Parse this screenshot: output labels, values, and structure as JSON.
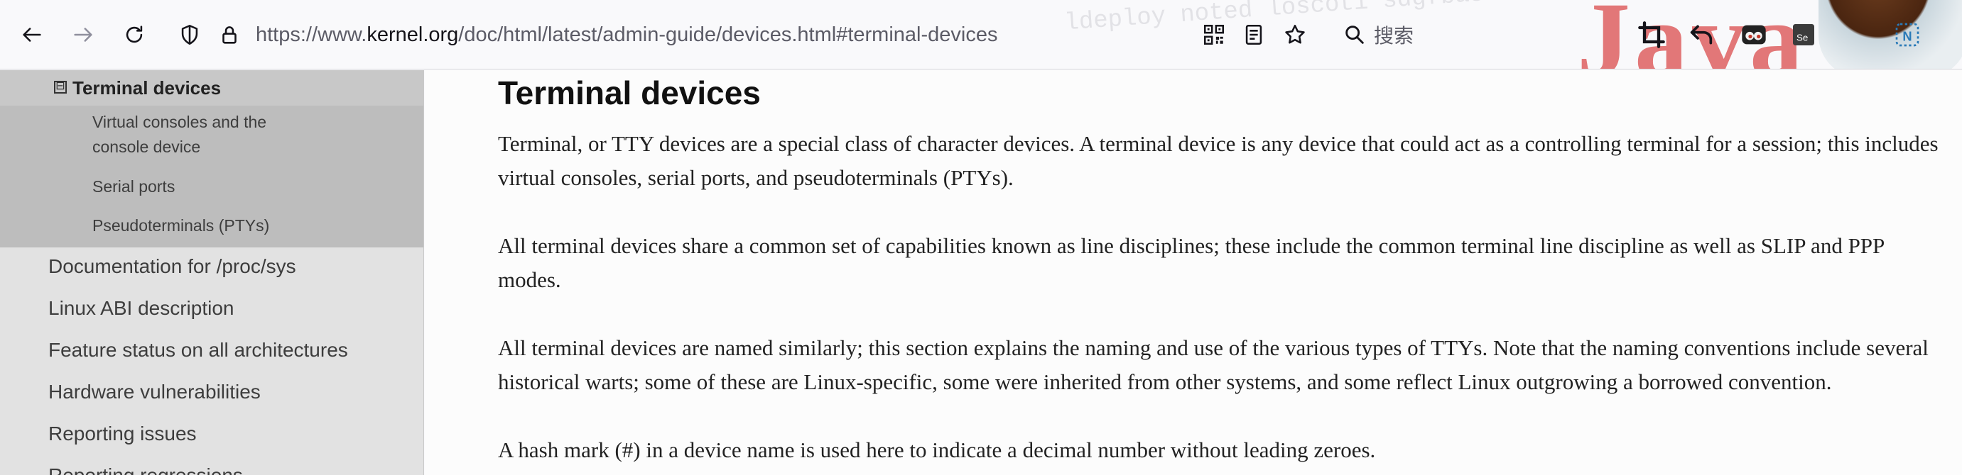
{
  "browser": {
    "url_prefix": "https://www.",
    "url_domain": "kernel.org",
    "url_path": "/doc/html/latest/admin-guide/devices.html#terminal-devices",
    "search_placeholder": "搜索",
    "deco_text": "Java"
  },
  "sidebar": {
    "current": {
      "label": "Terminal devices",
      "toggle": "⊟"
    },
    "subitems": [
      {
        "label_line1": "Virtual consoles and the",
        "label_line2": "console device"
      },
      {
        "label_line1": "Serial ports"
      },
      {
        "label_line1": "Pseudoterminals (PTYs)"
      }
    ],
    "items": [
      {
        "label": "Documentation for /proc/sys"
      },
      {
        "label": "Linux ABI description"
      },
      {
        "label": "Feature status on all architectures"
      },
      {
        "label": "Hardware vulnerabilities"
      },
      {
        "label": "Reporting issues"
      },
      {
        "label": "Reporting regressions"
      }
    ]
  },
  "main": {
    "title": "Terminal devices",
    "paragraphs": [
      "Terminal, or TTY devices are a special class of character devices. A terminal device is any device that could act as a controlling terminal for a session; this includes virtual consoles, serial ports, and pseudoterminals (PTYs).",
      "All terminal devices share a common set of capabilities known as line disciplines; these include the common terminal line discipline as well as SLIP and PPP modes.",
      "All terminal devices are named similarly; this section explains the naming and use of the various types of TTYs. Note that the naming conventions include several historical warts; some of these are Linux-specific, some were inherited from other systems, and some reflect Linux outgrowing a borrowed convention.",
      "A hash mark (#) in a device name is used here to indicate a decimal number without leading zeroes."
    ]
  },
  "colors": {
    "sidebar_bg": "#e2e2e2",
    "sidebar_current_bg": "#c8c8c8",
    "sidebar_sub_bg": "#bdbdbd",
    "content_bg": "#fcfcfc",
    "toolbar_bg": "#f9f9fb"
  },
  "icons": [
    "back-icon",
    "forward-icon",
    "reload-icon",
    "shield-icon",
    "lock-icon",
    "qr-code-icon",
    "reader-view-icon",
    "bookmark-star-icon",
    "search-icon",
    "crop-icon",
    "undo-icon",
    "extension-eyes-icon",
    "selenium-icon",
    "extension-n-icon"
  ]
}
